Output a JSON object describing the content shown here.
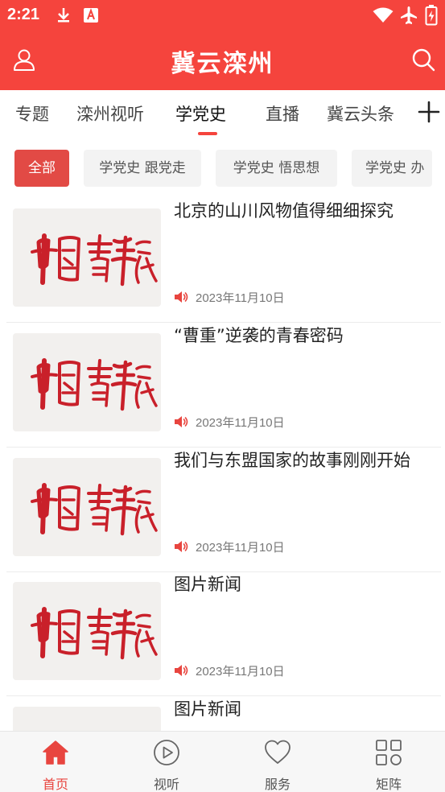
{
  "status_bar": {
    "time": "2:21",
    "icons": [
      "download-icon",
      "font-a-icon",
      "wifi-icon",
      "airplane-mode-icon",
      "battery-charging-icon"
    ]
  },
  "header": {
    "title": "冀云滦州",
    "left_icon": "user-icon",
    "right_icon": "search-icon"
  },
  "tabs": {
    "items": [
      "专题",
      "滦州视听",
      "学党史",
      "直播",
      "冀云头条"
    ],
    "active": "学党史",
    "add_icon": "plus-icon"
  },
  "chips": {
    "items": [
      "全部",
      "学党史 跟党走",
      "学党史  悟思想",
      "学党史  办"
    ],
    "active": "全部"
  },
  "articles": [
    {
      "title": "北京的山川风物值得细细探究",
      "date": "2023年11月10日",
      "thumbnail": "中国青年报"
    },
    {
      "title": "“曹重”逆袭的青春密码",
      "date": "2023年11月10日",
      "thumbnail": "中国青年报"
    },
    {
      "title": "我们与东盟国家的故事刚刚开始",
      "date": "2023年11月10日",
      "thumbnail": "中国青年报"
    },
    {
      "title": "图片新闻",
      "date": "2023年11月10日",
      "thumbnail": "中国青年报"
    },
    {
      "title": "图片新闻",
      "date": "",
      "thumbnail": "中国青年报"
    }
  ],
  "bottom_nav": {
    "items": [
      {
        "label": "首页",
        "icon": "home-icon"
      },
      {
        "label": "视听",
        "icon": "play-circle-icon"
      },
      {
        "label": "服务",
        "icon": "heart-icon"
      },
      {
        "label": "矩阵",
        "icon": "grid-icon"
      }
    ],
    "active": "首页"
  },
  "colors": {
    "brand_red": "#f5443d",
    "chip_active": "#e24a45",
    "calligraphy_red": "#c9202a"
  }
}
